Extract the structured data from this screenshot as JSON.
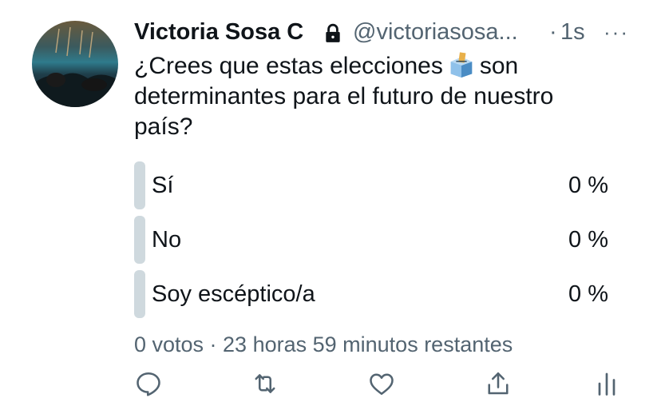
{
  "tweet": {
    "author_name": "Victoria Sosa C",
    "handle": "@victoriasosa...",
    "separator": "·",
    "time": "1s",
    "more": "···",
    "text_part1": "¿Crees que estas elecciones",
    "text_part2": "son determinantes para el futuro de nuestro país?",
    "emoji_icon": "ballot-box-icon"
  },
  "poll": {
    "options": [
      {
        "label": "Sí",
        "percent": "0 %"
      },
      {
        "label": "No",
        "percent": "0 %"
      },
      {
        "label": "Soy escéptico/a",
        "percent": "0 %"
      }
    ],
    "meta": "0 votos · 23 horas 59 minutos restantes"
  },
  "actions": [
    "reply-icon",
    "retweet-icon",
    "like-icon",
    "share-icon",
    "analytics-icon"
  ],
  "colors": {
    "secondary": "#536471",
    "bar": "#cfd9de",
    "text": "#0f1419"
  }
}
